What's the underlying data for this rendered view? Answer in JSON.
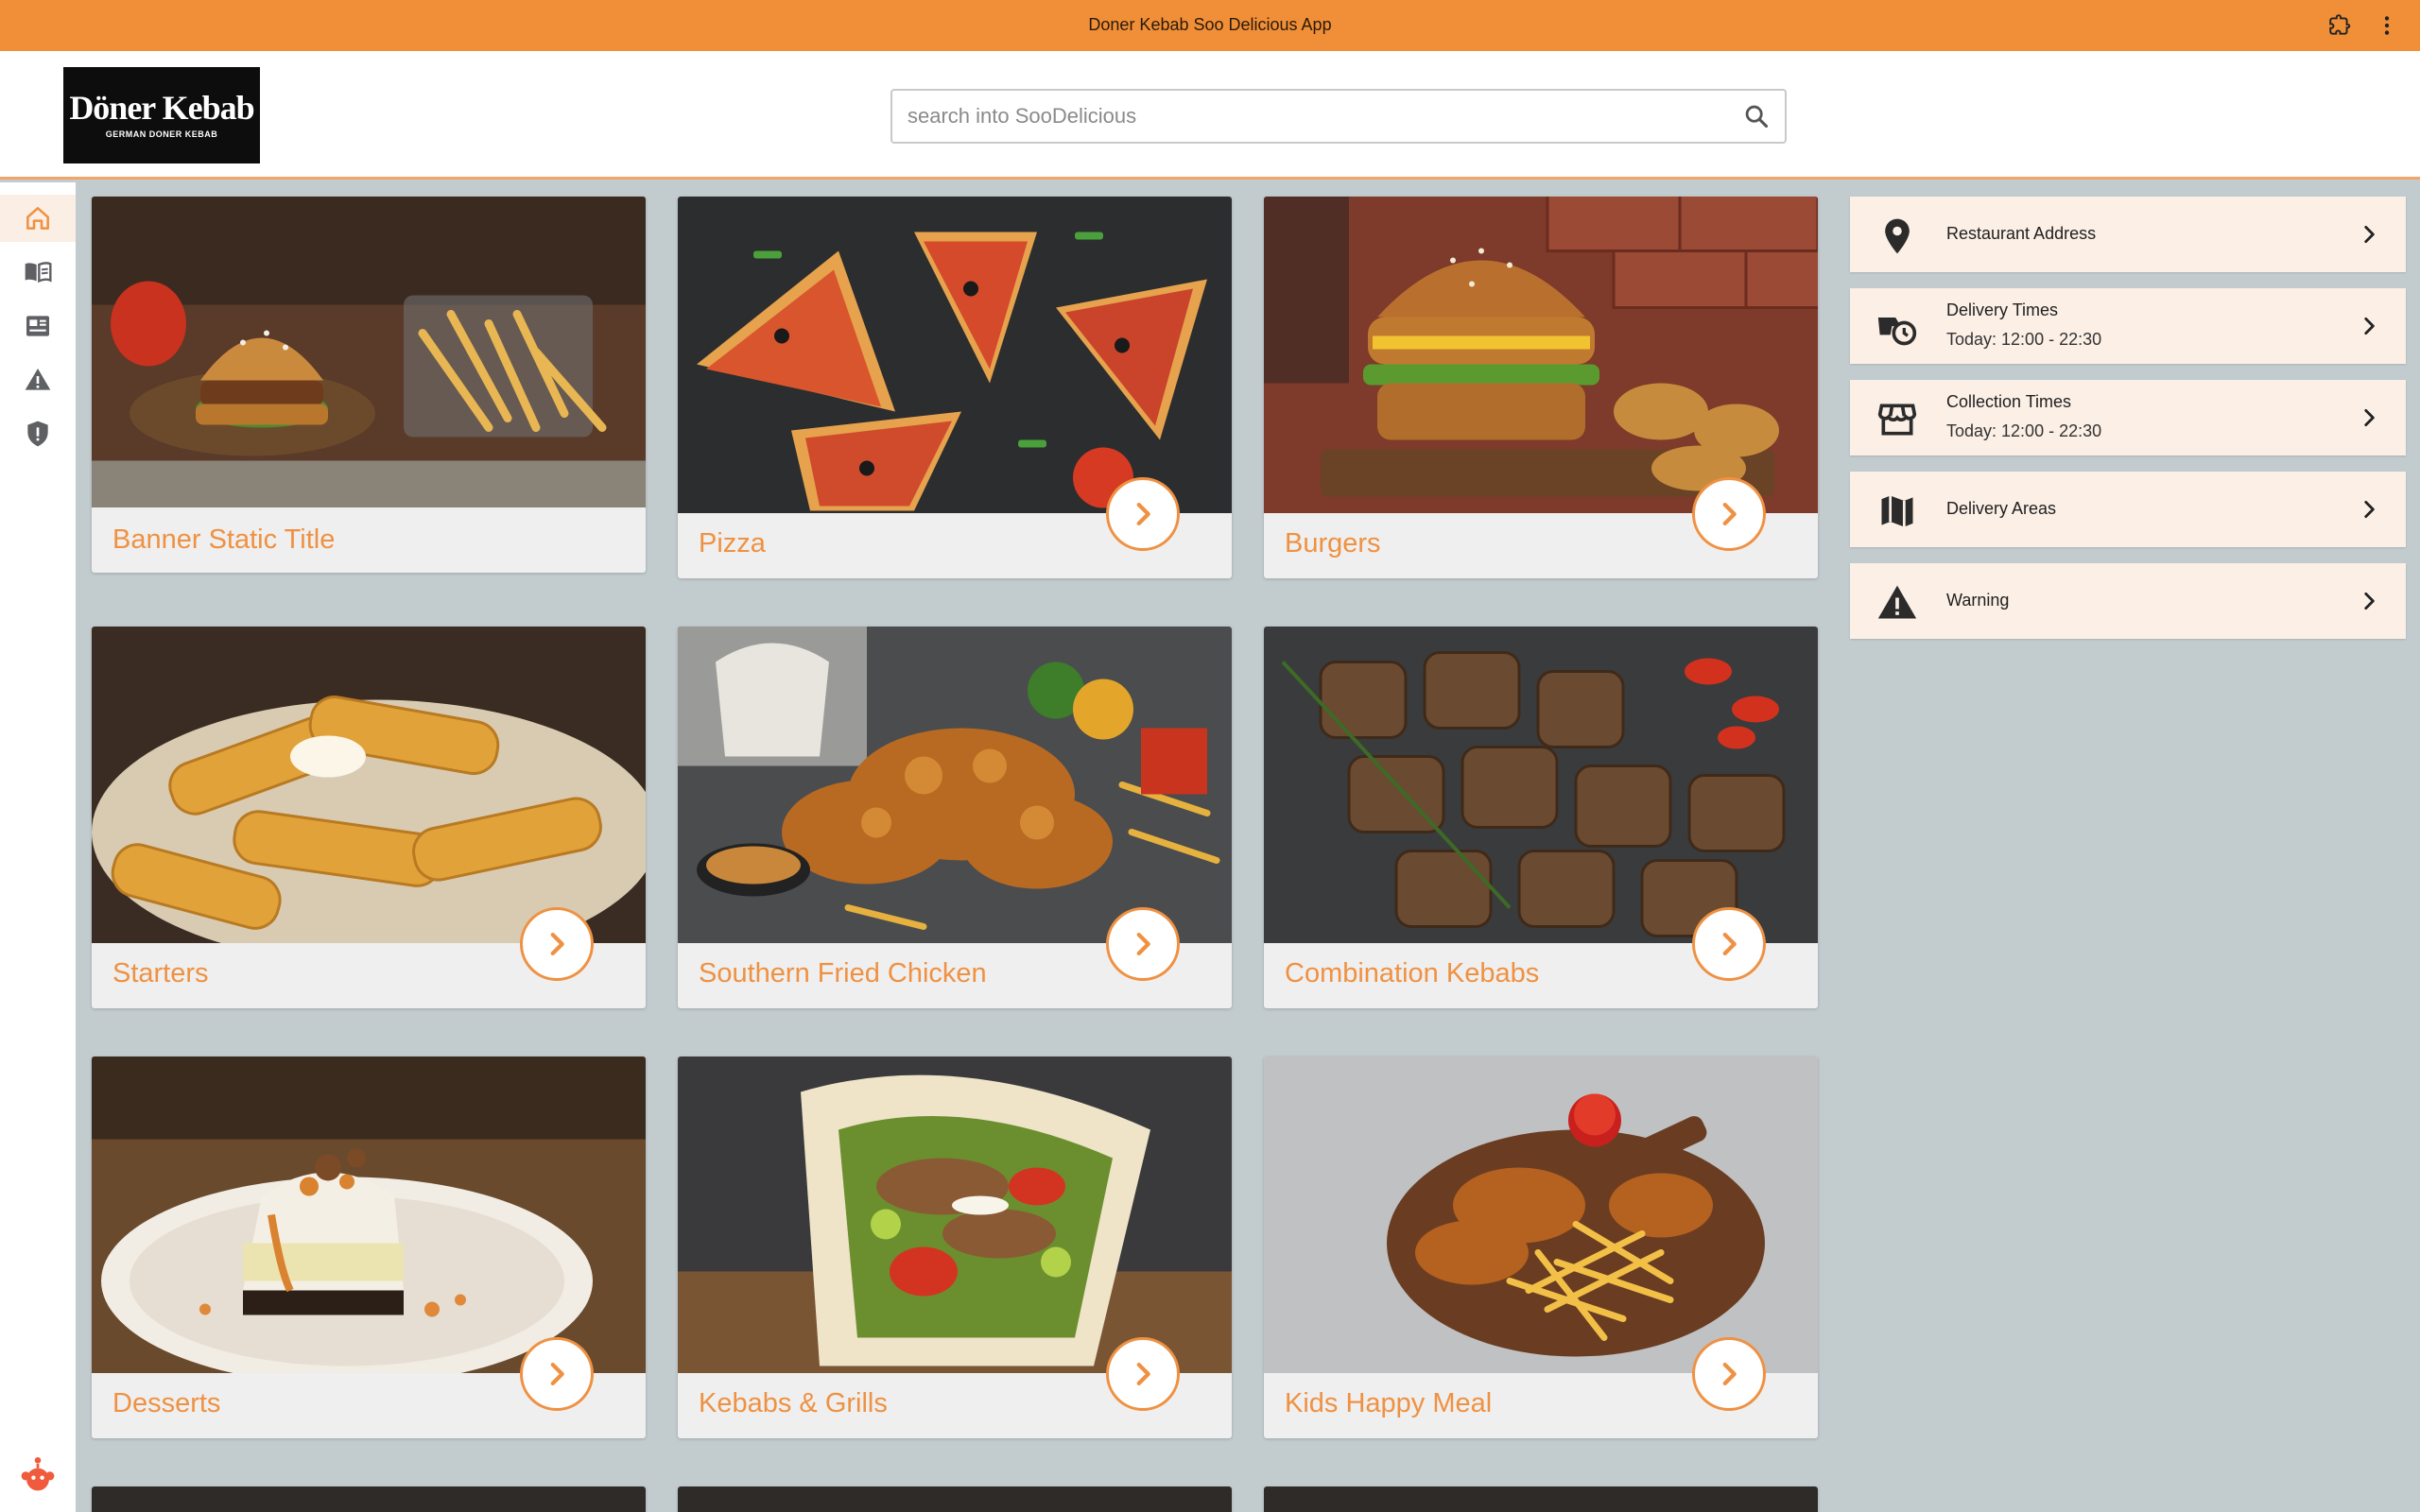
{
  "window": {
    "title": "Doner Kebab Soo Delicious App"
  },
  "header": {
    "logo": {
      "main": "Döner Kebab",
      "sub": "GERMAN DONER KEBAB"
    },
    "search": {
      "placeholder": "search into SooDelicious",
      "value": ""
    }
  },
  "sidebar": {
    "items": [
      {
        "name": "home",
        "icon": "home-icon",
        "active": true
      },
      {
        "name": "menu",
        "icon": "book-open-icon",
        "active": false
      },
      {
        "name": "news",
        "icon": "article-icon",
        "active": false
      },
      {
        "name": "warnings",
        "icon": "warning-icon",
        "active": false
      },
      {
        "name": "privacy",
        "icon": "shield-icon",
        "active": false
      }
    ],
    "bottom_icon": "app-mascot-icon"
  },
  "categories": [
    {
      "label": "Banner Static Title",
      "has_arrow": false,
      "image": "burger-and-fries-photo"
    },
    {
      "label": "Pizza",
      "has_arrow": true,
      "image": "pizza-slices-photo"
    },
    {
      "label": "Burgers",
      "has_arrow": true,
      "image": "crispy-chicken-burger-photo"
    },
    {
      "label": "Starters",
      "has_arrow": true,
      "image": "mozzarella-sticks-photo"
    },
    {
      "label": "Southern Fried Chicken",
      "has_arrow": true,
      "image": "fried-chicken-photo"
    },
    {
      "label": "Combination Kebabs",
      "has_arrow": true,
      "image": "grilled-kebab-pieces-photo"
    },
    {
      "label": "Desserts",
      "has_arrow": true,
      "image": "banoffee-pie-photo"
    },
    {
      "label": "Kebabs & Grills",
      "has_arrow": true,
      "image": "doner-wrap-photo"
    },
    {
      "label": "Kids Happy Meal",
      "has_arrow": true,
      "image": "chicken-and-fries-board-photo"
    }
  ],
  "info_panel": [
    {
      "title": "Restaurant Address",
      "subtitle": "",
      "icon": "location-pin-icon"
    },
    {
      "title": "Delivery Times",
      "subtitle": "Today: 12:00 - 22:30",
      "icon": "delivery-time-icon"
    },
    {
      "title": "Collection Times",
      "subtitle": "Today: 12:00 - 22:30",
      "icon": "storefront-icon"
    },
    {
      "title": "Delivery Areas",
      "subtitle": "",
      "icon": "map-icon"
    },
    {
      "title": "Warning",
      "subtitle": "",
      "icon": "warning-icon"
    }
  ],
  "colors": {
    "accent": "#f08f38",
    "label_orange": "#ef9142",
    "background": "#c2cbce",
    "info_card": "#fbefe6"
  }
}
